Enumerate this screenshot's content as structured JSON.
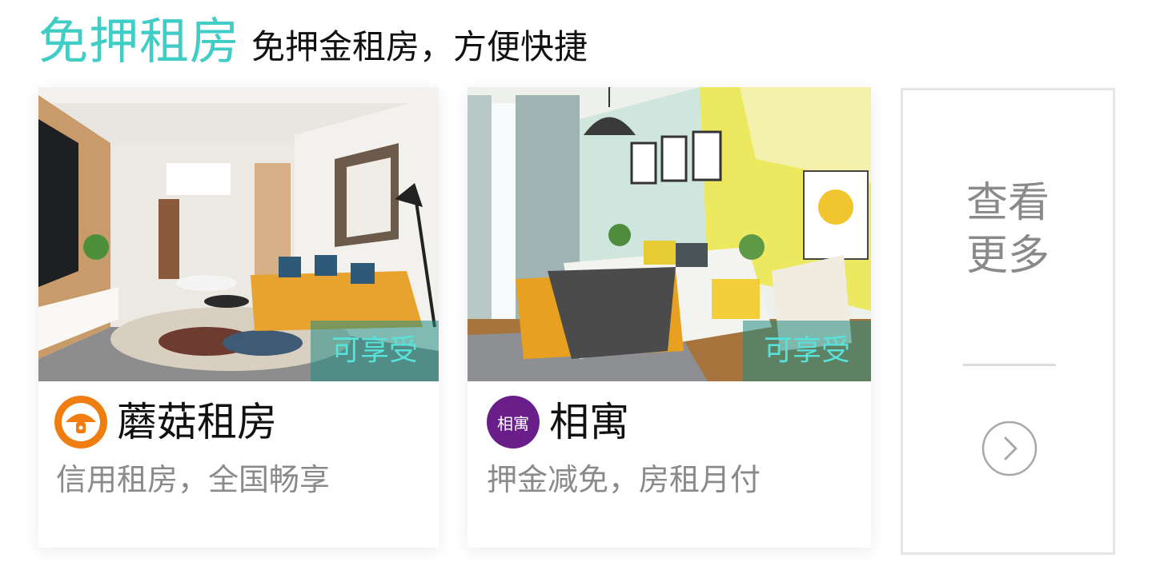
{
  "header": {
    "title": "免押租房",
    "subtitle": "免押金租房，方便快捷"
  },
  "cards": [
    {
      "brand": "蘑菇租房",
      "description": "信用租房，全国畅享",
      "tag": "可享受",
      "logo_icon": "mushroom-logo-icon",
      "logo_color": "#f07d10"
    },
    {
      "brand": "相寓",
      "description": "押金减免，房租月付",
      "tag": "可享受",
      "logo_text": "相寓",
      "logo_color": "#6a1e8a"
    }
  ],
  "more": {
    "line1": "查看",
    "line2": "更多",
    "arrow_icon": "chevron-right-circle-icon"
  },
  "colors": {
    "accent": "#3fcdc6",
    "tag_text": "#57e3da",
    "muted_text": "#8a8a8a"
  }
}
